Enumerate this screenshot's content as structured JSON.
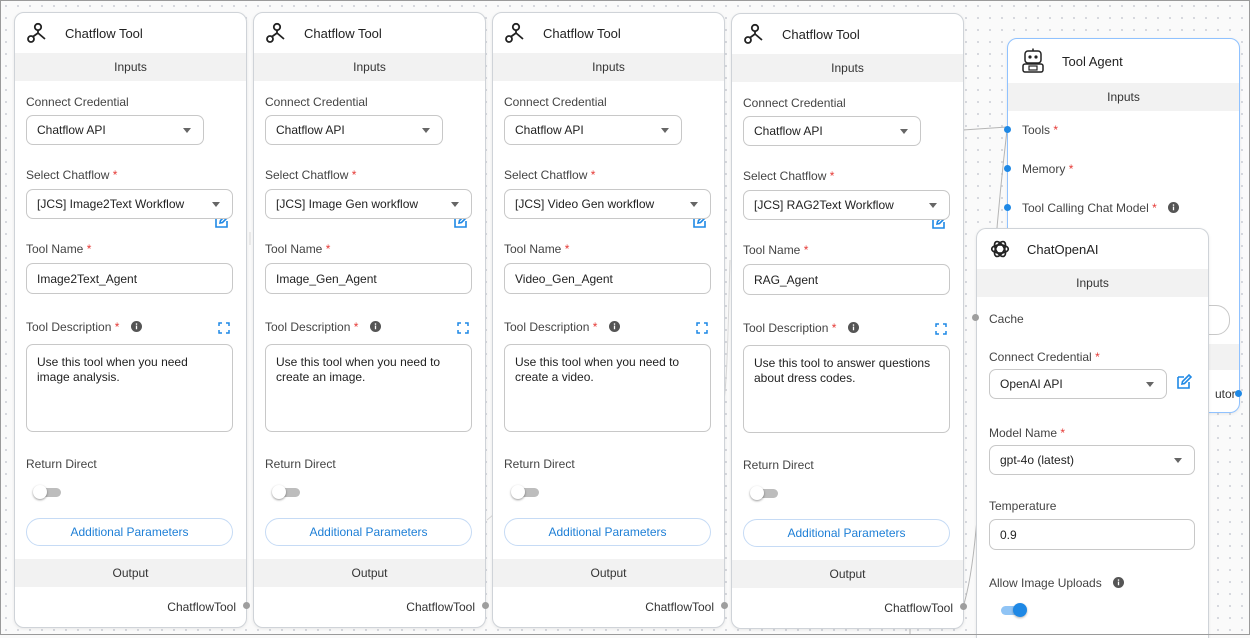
{
  "chatflow_nodes": [
    {
      "title": "Chatflow Tool",
      "inputs_label": "Inputs",
      "connect_credential_label": "Connect Credential",
      "credential_value": "Chatflow API",
      "select_chatflow_label": "Select Chatflow",
      "chatflow_value": "[JCS] Image2Text Workflow",
      "tool_name_label": "Tool Name",
      "tool_name_value": "Image2Text_Agent",
      "tool_description_label": "Tool Description",
      "tool_description_value": "Use this tool when you need image analysis.",
      "return_direct_label": "Return Direct",
      "additional_parameters_label": "Additional Parameters",
      "output_label": "Output",
      "output_value": "ChatflowTool"
    },
    {
      "title": "Chatflow Tool",
      "inputs_label": "Inputs",
      "connect_credential_label": "Connect Credential",
      "credential_value": "Chatflow API",
      "select_chatflow_label": "Select Chatflow",
      "chatflow_value": "[JCS] Image Gen workflow",
      "tool_name_label": "Tool Name",
      "tool_name_value": "Image_Gen_Agent",
      "tool_description_label": "Tool Description",
      "tool_description_value": "Use this tool when you need to create an image.",
      "return_direct_label": "Return Direct",
      "additional_parameters_label": "Additional Parameters",
      "output_label": "Output",
      "output_value": "ChatflowTool"
    },
    {
      "title": "Chatflow Tool",
      "inputs_label": "Inputs",
      "connect_credential_label": "Connect Credential",
      "credential_value": "Chatflow API",
      "select_chatflow_label": "Select Chatflow",
      "chatflow_value": "[JCS] Video Gen workflow",
      "tool_name_label": "Tool Name",
      "tool_name_value": "Video_Gen_Agent",
      "tool_description_label": "Tool Description",
      "tool_description_value": "Use this tool when you need to create a video.",
      "return_direct_label": "Return Direct",
      "additional_parameters_label": "Additional Parameters",
      "output_label": "Output",
      "output_value": "ChatflowTool"
    },
    {
      "title": "Chatflow Tool",
      "inputs_label": "Inputs",
      "connect_credential_label": "Connect Credential",
      "credential_value": "Chatflow API",
      "select_chatflow_label": "Select Chatflow",
      "chatflow_value": "[JCS] RAG2Text Workflow",
      "tool_name_label": "Tool Name",
      "tool_name_value": "RAG_Agent",
      "tool_description_label": "Tool Description",
      "tool_description_value": "Use this tool to answer questions about dress codes.",
      "return_direct_label": "Return Direct",
      "additional_parameters_label": "Additional Parameters",
      "output_label": "Output",
      "output_value": "ChatflowTool"
    }
  ],
  "tool_agent": {
    "title": "Tool Agent",
    "inputs_label": "Inputs",
    "tools_label": "Tools",
    "memory_label": "Memory",
    "chat_model_label": "Tool Calling Chat Model",
    "output_partial": "utor"
  },
  "chat_openai": {
    "title": "ChatOpenAI",
    "inputs_label": "Inputs",
    "cache_label": "Cache",
    "connect_credential_label": "Connect Credential",
    "credential_value": "OpenAI API",
    "model_name_label": "Model Name",
    "model_name_value": "gpt-4o (latest)",
    "temperature_label": "Temperature",
    "temperature_value": "0.9",
    "allow_image_uploads_label": "Allow Image Uploads",
    "allow_image_uploads_enabled": true
  },
  "required_marker": "*",
  "colors": {
    "accent": "#1e88e5",
    "required": "#e53935",
    "section_bg": "#f2f2f2"
  }
}
